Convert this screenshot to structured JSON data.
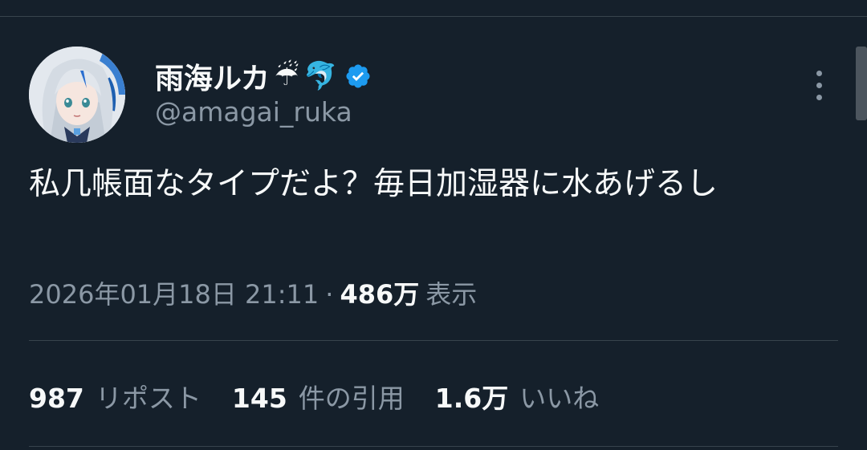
{
  "author": {
    "display_name": "雨海ルカ",
    "name_emojis": [
      "☔",
      "🐬"
    ],
    "handle": "@amagai_ruka",
    "verified_color": "#1d9bf0"
  },
  "tweet": {
    "text": "私几帳面なタイプだよ？毎日加湿器に水あげるし",
    "timestamp": "2026年01月18日 21:11",
    "separator": "·",
    "views_count": "486万",
    "views_label": "表示"
  },
  "stats": [
    {
      "count": "987",
      "label": "リポスト"
    },
    {
      "count": "145",
      "label": "件の引用"
    },
    {
      "count": "1.6万",
      "label": "いいね"
    }
  ],
  "icons": {
    "more": "more-vertical-icon",
    "verified": "verified-badge-icon"
  },
  "colors": {
    "background": "#15202b",
    "primary_text": "#f7f9f9",
    "secondary_text": "#8b98a5",
    "divider": "#38444d"
  }
}
